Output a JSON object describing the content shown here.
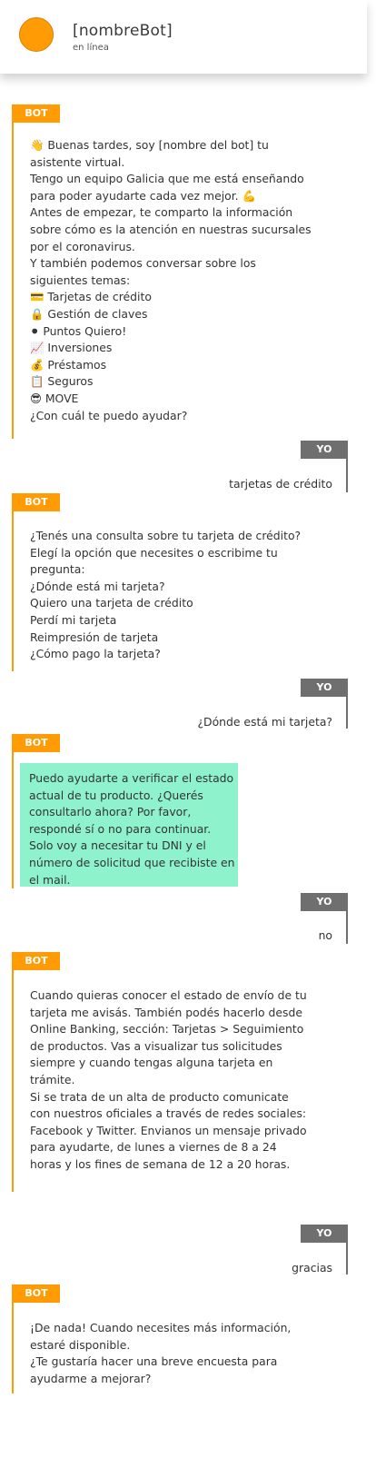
{
  "header": {
    "name": "[nombreBot]",
    "status": "en línea"
  },
  "tags": {
    "bot": "BOT",
    "user": "YO"
  },
  "messages": {
    "bot1": "👋 Buenas tardes, soy [nombre del bot] tu asistente virtual.\nTengo un equipo Galicia que me está enseñando para poder ayudarte cada vez mejor. 💪\nAntes de empezar, te comparto la información sobre cómo es la atención en nuestras sucursales por el coronavirus.\nY también podemos conversar sobre los siguientes temas:\n💳 Tarjetas de crédito\n🔒 Gestión de claves\n⚫ Puntos Quiero!\n📈 Inversiones\n💰 Préstamos\n📋 Seguros\n😎 MOVE\n¿Con cuál te puedo ayudar?",
    "user1": "tarjetas de crédito",
    "bot2": "¿Tenés una consulta sobre tu tarjeta de crédito?\nElegí la opción que necesites o escribime tu pregunta:\n¿Dónde está mi tarjeta?\nQuiero una tarjeta de crédito\nPerdí mi tarjeta\nReimpresión de tarjeta\n¿Cómo pago la tarjeta?",
    "user2": "¿Dónde está mi tarjeta?",
    "bot3": "Puedo ayudarte a verificar el estado actual de tu producto. ¿Querés consultarlo ahora? Por favor, respondé sí o no para continuar.\nSolo voy a necesitar tu DNI y el número de solicitud que recibiste en el mail.",
    "user3": "no",
    "bot4": "Cuando quieras conocer el estado de envío de tu tarjeta me avisás. También podés hacerlo desde Online Banking, sección: Tarjetas > Seguimiento de productos. Vas a visualizar tus solicitudes siempre y cuando tengas alguna tarjeta en trámite.\nSi se trata de un alta de producto comunicate con nuestros oficiales a través de redes sociales: Facebook y Twitter. Envianos un mensaje privado para ayudarte, de lunes a viernes de 8 a 24 horas y los fines de semana de 12 a 20 horas.",
    "user4": "gracias",
    "bot5": "¡De nada! Cuando necesites más información, estaré disponible.\n¿Te gustaría hacer una breve encuesta para ayudarme a mejorar?"
  },
  "colors": {
    "bot_accent": "#ff9b05",
    "user_accent": "#6f6f6f",
    "highlight_bubble": "#8ef3cd"
  }
}
